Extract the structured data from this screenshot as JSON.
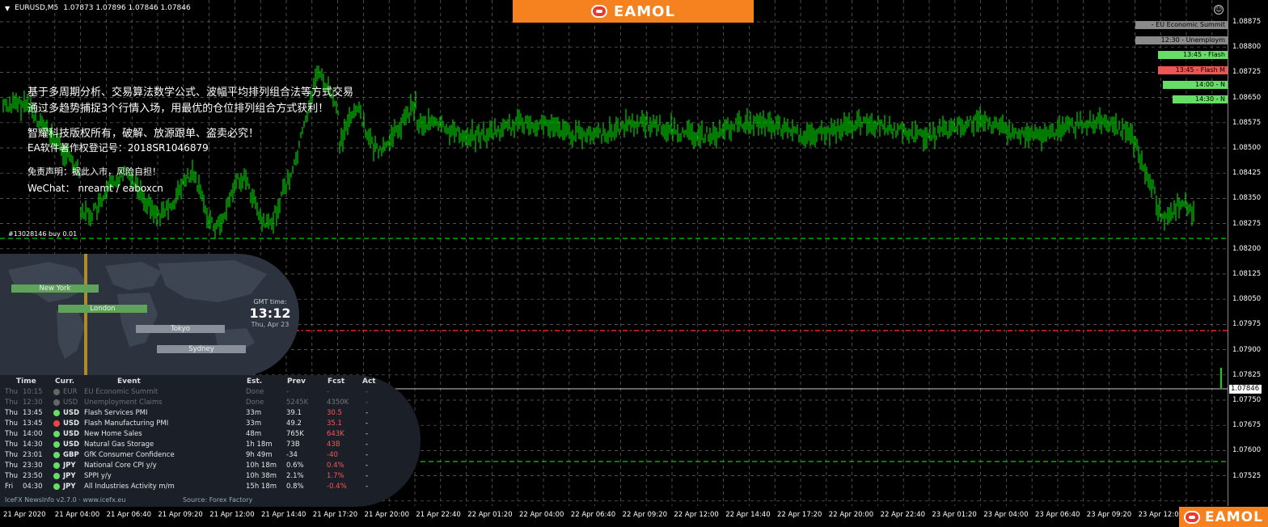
{
  "symbol": {
    "name": "EURUSD,M5",
    "ohlc": "1.07873 1.07896 1.07846 1.07846"
  },
  "brand": {
    "text": "EAMOL"
  },
  "info_lines": [
    "基于多周期分析、交易算法数学公式、波幅平均排列组合法等方式交易",
    "通过多趋势捕捉3个行情入场，用最优的仓位排列组合方式获利！",
    "智耀科技版权所有，破解、放源跟单、盗卖必究！",
    "EA软件著作权登记号：2018SR1046879",
    "免责声明：据此入市，风险自担！",
    "WeChat： nreamt / eaboxcn"
  ],
  "order_label": "#13028146 buy 0.01",
  "price_axis": [
    "1.08875",
    "1.08800",
    "1.08725",
    "1.08650",
    "1.08575",
    "1.08500",
    "1.08425",
    "1.08350",
    "1.08275",
    "1.08200",
    "1.08125",
    "1.08050",
    "1.07975",
    "1.07900",
    "1.07825",
    "1.07750",
    "1.07675",
    "1.07600",
    "1.07525"
  ],
  "current_price": "1.07846",
  "time_axis": [
    "21 Apr 2020",
    "21 Apr 04:00",
    "21 Apr 06:40",
    "21 Apr 09:20",
    "21 Apr 12:00",
    "21 Apr 14:40",
    "21 Apr 17:20",
    "21 Apr 20:00",
    "21 Apr 22:40",
    "22 Apr 01:20",
    "22 Apr 04:00",
    "22 Apr 06:40",
    "22 Apr 09:20",
    "22 Apr 12:00",
    "22 Apr 14:40",
    "22 Apr 17:20",
    "22 Apr 20:00",
    "22 Apr 22:40",
    "23 Apr 01:20",
    "23 Apr 04:00",
    "23 Apr 06:40",
    "23 Apr 09:20",
    "23 Apr 12:00"
  ],
  "event_tags": [
    {
      "text": "- EU Economic Summit",
      "color": "#8a8a8a"
    },
    {
      "text": "12:30 - Unemploym",
      "color": "#8a8a8a"
    },
    {
      "text": "13:45 - Flash",
      "color": "#66dd66"
    },
    {
      "text": "13:45 - Flash M",
      "color": "#ee5555"
    },
    {
      "text": "14:00 - N",
      "color": "#66dd66"
    },
    {
      "text": "14:30 - N",
      "color": "#66dd66"
    }
  ],
  "sessions": [
    "New York",
    "London",
    "Tokyo",
    "Sydney"
  ],
  "gmt": {
    "label": "GMT time:",
    "time": "13:12",
    "date": "Thu, Apr 23"
  },
  "news_headers": [
    "Time",
    "Curr.",
    "Event",
    "Est.",
    "Prev",
    "Fcst",
    "Act"
  ],
  "news_rows": [
    {
      "day": "Thu",
      "time": "10:15",
      "cur": "EUR",
      "event": "EU Economic Summit",
      "est": "Done",
      "prev": "-",
      "fcst": "-",
      "act": "-",
      "dot": "#666666",
      "dim": true,
      "fcol": "#777777"
    },
    {
      "day": "Thu",
      "time": "12:30",
      "cur": "USD",
      "event": "Unemployment Claims",
      "est": "Done",
      "prev": "5245K",
      "fcst": "4350K",
      "act": "-",
      "dot": "#666666",
      "dim": true,
      "fcol": "#777777"
    },
    {
      "day": "Thu",
      "time": "13:45",
      "cur": "USD",
      "event": "Flash Services PMI",
      "est": "33m",
      "prev": "39.1",
      "fcst": "30.5",
      "act": "-",
      "dot": "#66dd66",
      "dim": false,
      "fcol": "#ff5555"
    },
    {
      "day": "Thu",
      "time": "13:45",
      "cur": "USD",
      "event": "Flash Manufacturing PMI",
      "est": "33m",
      "prev": "49.2",
      "fcst": "35.1",
      "act": "-",
      "dot": "#ee4444",
      "dim": false,
      "fcol": "#ff5555"
    },
    {
      "day": "Thu",
      "time": "14:00",
      "cur": "USD",
      "event": "New Home Sales",
      "est": "48m",
      "prev": "765K",
      "fcst": "643K",
      "act": "-",
      "dot": "#66dd66",
      "dim": false,
      "fcol": "#ff5555"
    },
    {
      "day": "Thu",
      "time": "14:30",
      "cur": "USD",
      "event": "Natural Gas Storage",
      "est": "1h 18m",
      "prev": "73B",
      "fcst": "43B",
      "act": "-",
      "dot": "#66dd66",
      "dim": false,
      "fcol": "#ff5555"
    },
    {
      "day": "Thu",
      "time": "23:01",
      "cur": "GBP",
      "event": "GfK Consumer Confidence",
      "est": "9h 49m",
      "prev": "-34",
      "fcst": "-40",
      "act": "-",
      "dot": "#66dd66",
      "dim": false,
      "fcol": "#ff5555"
    },
    {
      "day": "Thu",
      "time": "23:30",
      "cur": "JPY",
      "event": "National Core CPI y/y",
      "est": "10h 18m",
      "prev": "0.6%",
      "fcst": "0.4%",
      "act": "-",
      "dot": "#66dd66",
      "dim": false,
      "fcol": "#ff5555"
    },
    {
      "day": "Thu",
      "time": "23:50",
      "cur": "JPY",
      "event": "SPPI y/y",
      "est": "10h 38m",
      "prev": "2.1%",
      "fcst": "1.7%",
      "act": "-",
      "dot": "#66dd66",
      "dim": false,
      "fcol": "#ff5555"
    },
    {
      "day": "Fri",
      "time": "04:30",
      "cur": "JPY",
      "event": "All Industries Activity m/m",
      "est": "15h 18m",
      "prev": "0.8%",
      "fcst": "-0.4%",
      "act": "-",
      "dot": "#66dd66",
      "dim": false,
      "fcol": "#ff5555"
    }
  ],
  "news_footer": {
    "version": "IceFX NewsInfo v2.7.0 · www.icefx.eu",
    "source": "Source: Forex Factory"
  },
  "colors": {
    "candles": "#00e000",
    "grid": "#6a6a6a",
    "order_line": "#00cc00",
    "level_line": "#ee2222",
    "cur_line": "#c8c8c8"
  }
}
